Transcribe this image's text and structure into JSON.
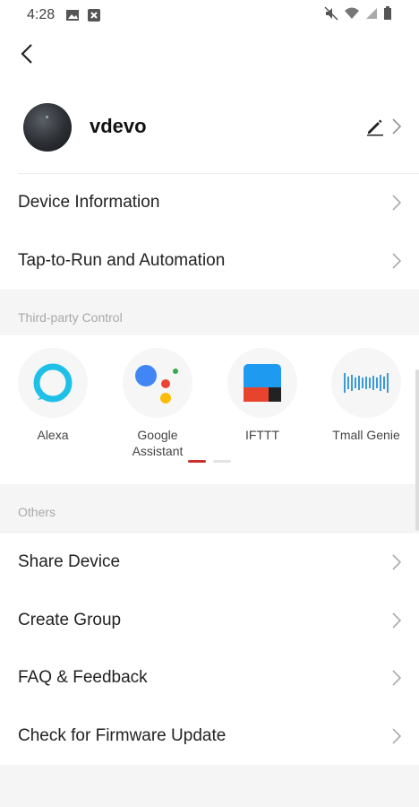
{
  "status_bar": {
    "time": "4:28"
  },
  "device": {
    "name": "vdevo"
  },
  "top_rows": [
    {
      "label": "Device Information"
    },
    {
      "label": "Tap-to-Run and Automation"
    }
  ],
  "third_party": {
    "section_title": "Third-party Control",
    "items": [
      {
        "label": "Alexa",
        "icon": "alexa-icon"
      },
      {
        "label": "Google Assistant",
        "icon": "google-assistant-icon"
      },
      {
        "label": "IFTTT",
        "icon": "ifttt-icon"
      },
      {
        "label": "Tmall Genie",
        "icon": "tmall-genie-icon"
      }
    ],
    "page_count": 2,
    "current_page": 1
  },
  "others": {
    "section_title": "Others",
    "rows": [
      {
        "label": "Share Device"
      },
      {
        "label": "Create Group"
      },
      {
        "label": "FAQ & Feedback"
      },
      {
        "label": "Check for Firmware Update"
      }
    ]
  },
  "colors": {
    "accent": "#c9302c",
    "alexa": "#1ec0e8",
    "ifttt_blue": "#1e9bf0",
    "ifttt_red": "#e8432c",
    "tmall_blue": "#3a9bd8"
  }
}
